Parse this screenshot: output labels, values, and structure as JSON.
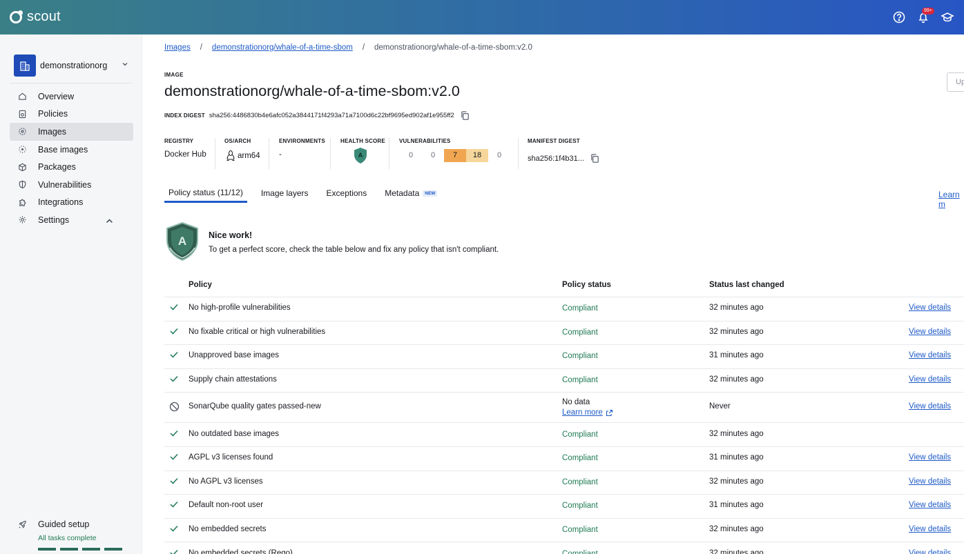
{
  "app": {
    "name": "scout",
    "notifications_badge": "99+"
  },
  "org": {
    "name": "demonstrationorg"
  },
  "sidebar": {
    "items": [
      {
        "label": "Overview",
        "icon": "home-icon"
      },
      {
        "label": "Policies",
        "icon": "policy-icon"
      },
      {
        "label": "Images",
        "icon": "images-icon",
        "active": true
      },
      {
        "label": "Base images",
        "icon": "base-images-icon"
      },
      {
        "label": "Packages",
        "icon": "package-icon"
      },
      {
        "label": "Vulnerabilities",
        "icon": "shield-icon"
      },
      {
        "label": "Integrations",
        "icon": "puzzle-icon"
      },
      {
        "label": "Settings",
        "icon": "gear-icon"
      }
    ],
    "guided_title": "Guided setup",
    "guided_sub": "All tasks complete",
    "guided_progress": "4 of 4 segments complete"
  },
  "breadcrumb": {
    "root": "Images",
    "repo": "demonstrationorg/whale-of-a-time-sbom",
    "current": "demonstrationorg/whale-of-a-time-sbom:v2.0",
    "sep": "/"
  },
  "header": {
    "kicker": "IMAGE",
    "title": "demonstrationorg/whale-of-a-time-sbom:v2.0",
    "digest_label": "INDEX DIGEST",
    "digest_value": "sha256:4486830b4e6afc052a3844171f4293a71a7100d6c22bf9695ed902af1e955ff2",
    "update_button": "Up"
  },
  "meta": {
    "registry_label": "REGISTRY",
    "registry_value": "Docker Hub",
    "osarch_label": "OS/ARCH",
    "osarch_value": "arm64",
    "env_label": "ENVIRONMENTS",
    "env_value": "-",
    "health_label": "HEALTH SCORE",
    "health_value": "A",
    "vuln_label": "VULNERABILITIES",
    "vulns": {
      "c": "0",
      "h_prev": "0",
      "h": "7",
      "m": "18",
      "l": "0"
    },
    "manifest_label": "MANIFEST DIGEST",
    "manifest_value": "sha256:1f4b31..."
  },
  "tabs": [
    {
      "label": "Policy status (11/12)",
      "active": true
    },
    {
      "label": "Image layers"
    },
    {
      "label": "Exceptions"
    },
    {
      "label": "Metadata",
      "badge": "NEW"
    }
  ],
  "learn_more_right": "Learn m",
  "banner": {
    "badge_letter": "A",
    "title": "Nice work!",
    "subtitle": "To get a perfect score, check the table below and fix any policy that isn't compliant."
  },
  "table": {
    "headers": {
      "policy": "Policy",
      "status": "Policy status",
      "changed": "Status last changed"
    },
    "rows": [
      {
        "policy": "No high-profile vulnerabilities",
        "status": "Compliant",
        "changed": "32 minutes ago",
        "link": "View details"
      },
      {
        "policy": "No fixable critical or high vulnerabilities",
        "status": "Compliant",
        "changed": "32 minutes ago",
        "link": "View details"
      },
      {
        "policy": "Unapproved base images",
        "status": "Compliant",
        "changed": "31 minutes ago",
        "link": "View details"
      },
      {
        "policy": "Supply chain attestations",
        "status": "Compliant",
        "changed": "32 minutes ago",
        "link": "View details"
      },
      {
        "policy": "SonarQube quality gates passed-new",
        "status": "No data",
        "status_link": "Learn more",
        "changed": "Never",
        "link": "View details",
        "nodata": true
      },
      {
        "policy": "No outdated base images",
        "status": "Compliant",
        "changed": "32 minutes ago",
        "link": ""
      },
      {
        "policy": "AGPL v3 licenses found",
        "status": "Compliant",
        "changed": "31 minutes ago",
        "link": "View details"
      },
      {
        "policy": "No AGPL v3 licenses",
        "status": "Compliant",
        "changed": "32 minutes ago",
        "link": "View details"
      },
      {
        "policy": "Default non-root user",
        "status": "Compliant",
        "changed": "31 minutes ago",
        "link": "View details"
      },
      {
        "policy": "No embedded secrets",
        "status": "Compliant",
        "changed": "32 minutes ago",
        "link": "View details"
      },
      {
        "policy": "No embedded secrets (Rego)",
        "status": "Compliant",
        "changed": "32 minutes ago",
        "link": "View details"
      }
    ]
  }
}
